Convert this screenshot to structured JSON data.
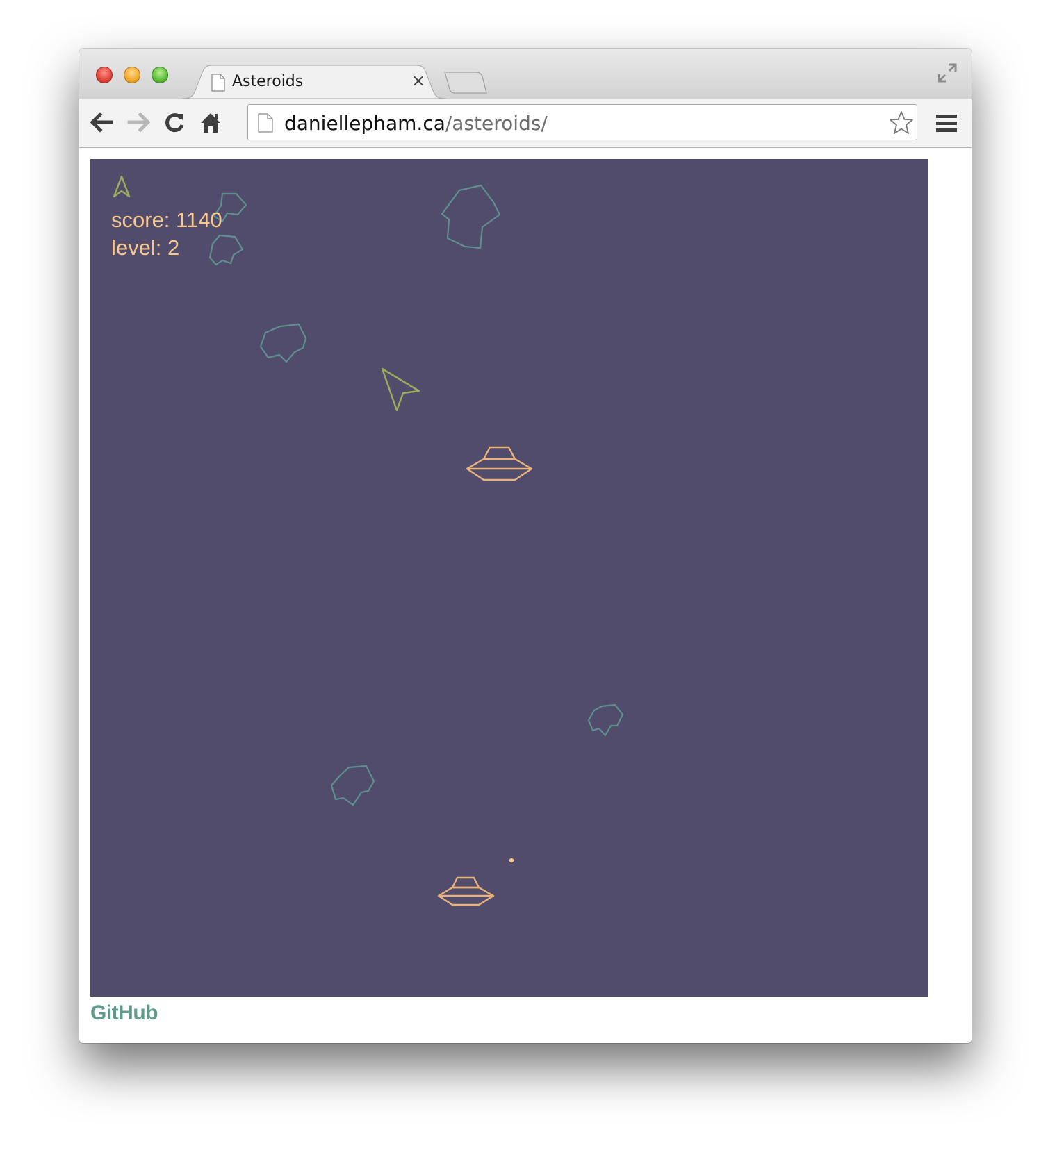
{
  "browser": {
    "tab_title": "Asteroids",
    "close_symbol": "×",
    "url_host": "daniellepham.ca",
    "url_path": "/asteroids/"
  },
  "game": {
    "score_text": "score: 1140",
    "level_text": "level: 2",
    "colors": {
      "background": "#514c6c",
      "ship": "#9aab5c",
      "asteroid": "#5f8f8c",
      "ufo": "#e8b27a",
      "hud": "#f6c78f"
    }
  },
  "footer": {
    "github_label": "GitHub"
  }
}
